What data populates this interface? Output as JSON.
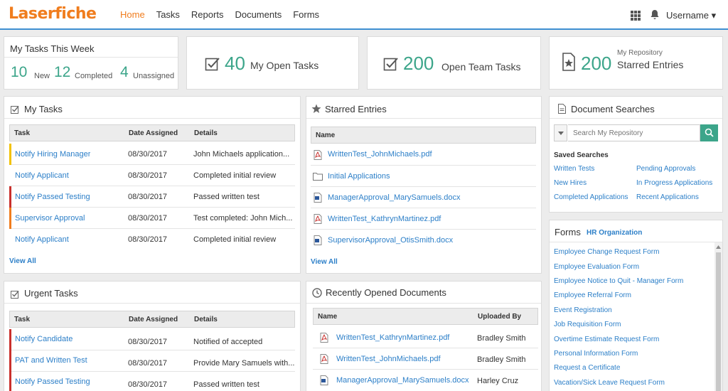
{
  "app": {
    "logo": "Laserfiche"
  },
  "nav": {
    "items": [
      "Home",
      "Tasks",
      "Reports",
      "Documents",
      "Forms"
    ],
    "active": "Home"
  },
  "user": {
    "name": "Username ▾"
  },
  "week": {
    "title": "My Tasks This Week",
    "new_count": "10",
    "new_label": "New",
    "completed_count": "12",
    "completed_label": "Completed",
    "unassigned_count": "4",
    "unassigned_label": "Unassigned"
  },
  "open_tasks": {
    "count": "40",
    "label": "My Open Tasks"
  },
  "team_tasks": {
    "count": "200",
    "label": "Open Team Tasks"
  },
  "repository": {
    "sublabel": "My Repository",
    "count": "200",
    "label": "Starred Entries"
  },
  "my_tasks": {
    "title": "My Tasks",
    "columns": [
      "Task",
      "Date Assigned",
      "Details"
    ],
    "rows": [
      {
        "task": "Notify Hiring Manager",
        "date": "08/30/2017",
        "details": "John Michaels application...",
        "color": "#f2c200"
      },
      {
        "task": "Notify Applicant",
        "date": "08/30/2017",
        "details": "Completed initial review",
        "color": ""
      },
      {
        "task": "Notify Passed Testing",
        "date": "08/30/2017",
        "details": "Passed written test",
        "color": "#c9302c"
      },
      {
        "task": "Supervisor Approval",
        "date": "08/30/2017",
        "details": "Test completed: John Mich...",
        "color": "#f07d1e"
      },
      {
        "task": "Notify Applicant",
        "date": "08/30/2017",
        "details": "Completed initial review",
        "color": ""
      }
    ],
    "view_all": "View All"
  },
  "urgent_tasks": {
    "title": "Urgent Tasks",
    "columns": [
      "Task",
      "Date Assigned",
      "Details"
    ],
    "rows": [
      {
        "task": "Notify Candidate",
        "date": "08/30/2017",
        "details": "Notified of accepted",
        "color": "#c9302c"
      },
      {
        "task": "PAT and Written Test",
        "date": "08/30/2017",
        "details": "Provide Mary Samuels with...",
        "color": "#c9302c"
      },
      {
        "task": "Notify Passed Testing",
        "date": "08/30/2017",
        "details": "Passed written test",
        "color": "#c9302c"
      }
    ]
  },
  "starred": {
    "title": "Starred Entries",
    "column": "Name",
    "files": [
      {
        "name": "WrittenTest_JohnMichaels.pdf",
        "type": "pdf"
      },
      {
        "name": "Initial Applications",
        "type": "folder"
      },
      {
        "name": "ManagerApproval_MarySamuels.docx",
        "type": "docx"
      },
      {
        "name": "WrittenTest_KathrynMartinez.pdf",
        "type": "pdf"
      },
      {
        "name": "SupervisorApproval_OtisSmith.docx",
        "type": "docx"
      }
    ],
    "view_all": "View All"
  },
  "recent": {
    "title": "Recently Opened Documents",
    "columns": [
      "Name",
      "Uploaded By"
    ],
    "files": [
      {
        "name": "WrittenTest_KathrynMartinez.pdf",
        "type": "pdf",
        "by": "Bradley Smith"
      },
      {
        "name": "WrittenTest_JohnMichaels.pdf",
        "type": "pdf",
        "by": "Bradley Smith"
      },
      {
        "name": "ManagerApproval_MarySamuels.docx",
        "type": "docx",
        "by": "Harley Cruz"
      }
    ]
  },
  "searches": {
    "title": "Document Searches",
    "placeholder": "Search My Repository",
    "saved_title": "Saved Searches",
    "left": [
      "Written Tests",
      "New Hires",
      "Completed Applications"
    ],
    "right": [
      "Pending Approvals",
      "In Progress Applications",
      "Recent Applications"
    ]
  },
  "forms": {
    "title": "Forms",
    "org": "HR Organization",
    "items": [
      "Employee Change Request Form",
      "Employee Evaluation Form",
      "Employee Notice to Quit - Manager Form",
      "Employee Referral Form",
      "Event Registration",
      "Job Requisition Form",
      "Overtime Estimate Request Form",
      "Personal Information Form",
      "Request a Certificate",
      "Vacation/Sick Leave Request Form"
    ]
  },
  "colors": {
    "accent": "#f07d1e",
    "stat": "#3ca58a",
    "link": "#2c7fc8",
    "urgent": "#c9302c",
    "warning": "#f2c200"
  }
}
